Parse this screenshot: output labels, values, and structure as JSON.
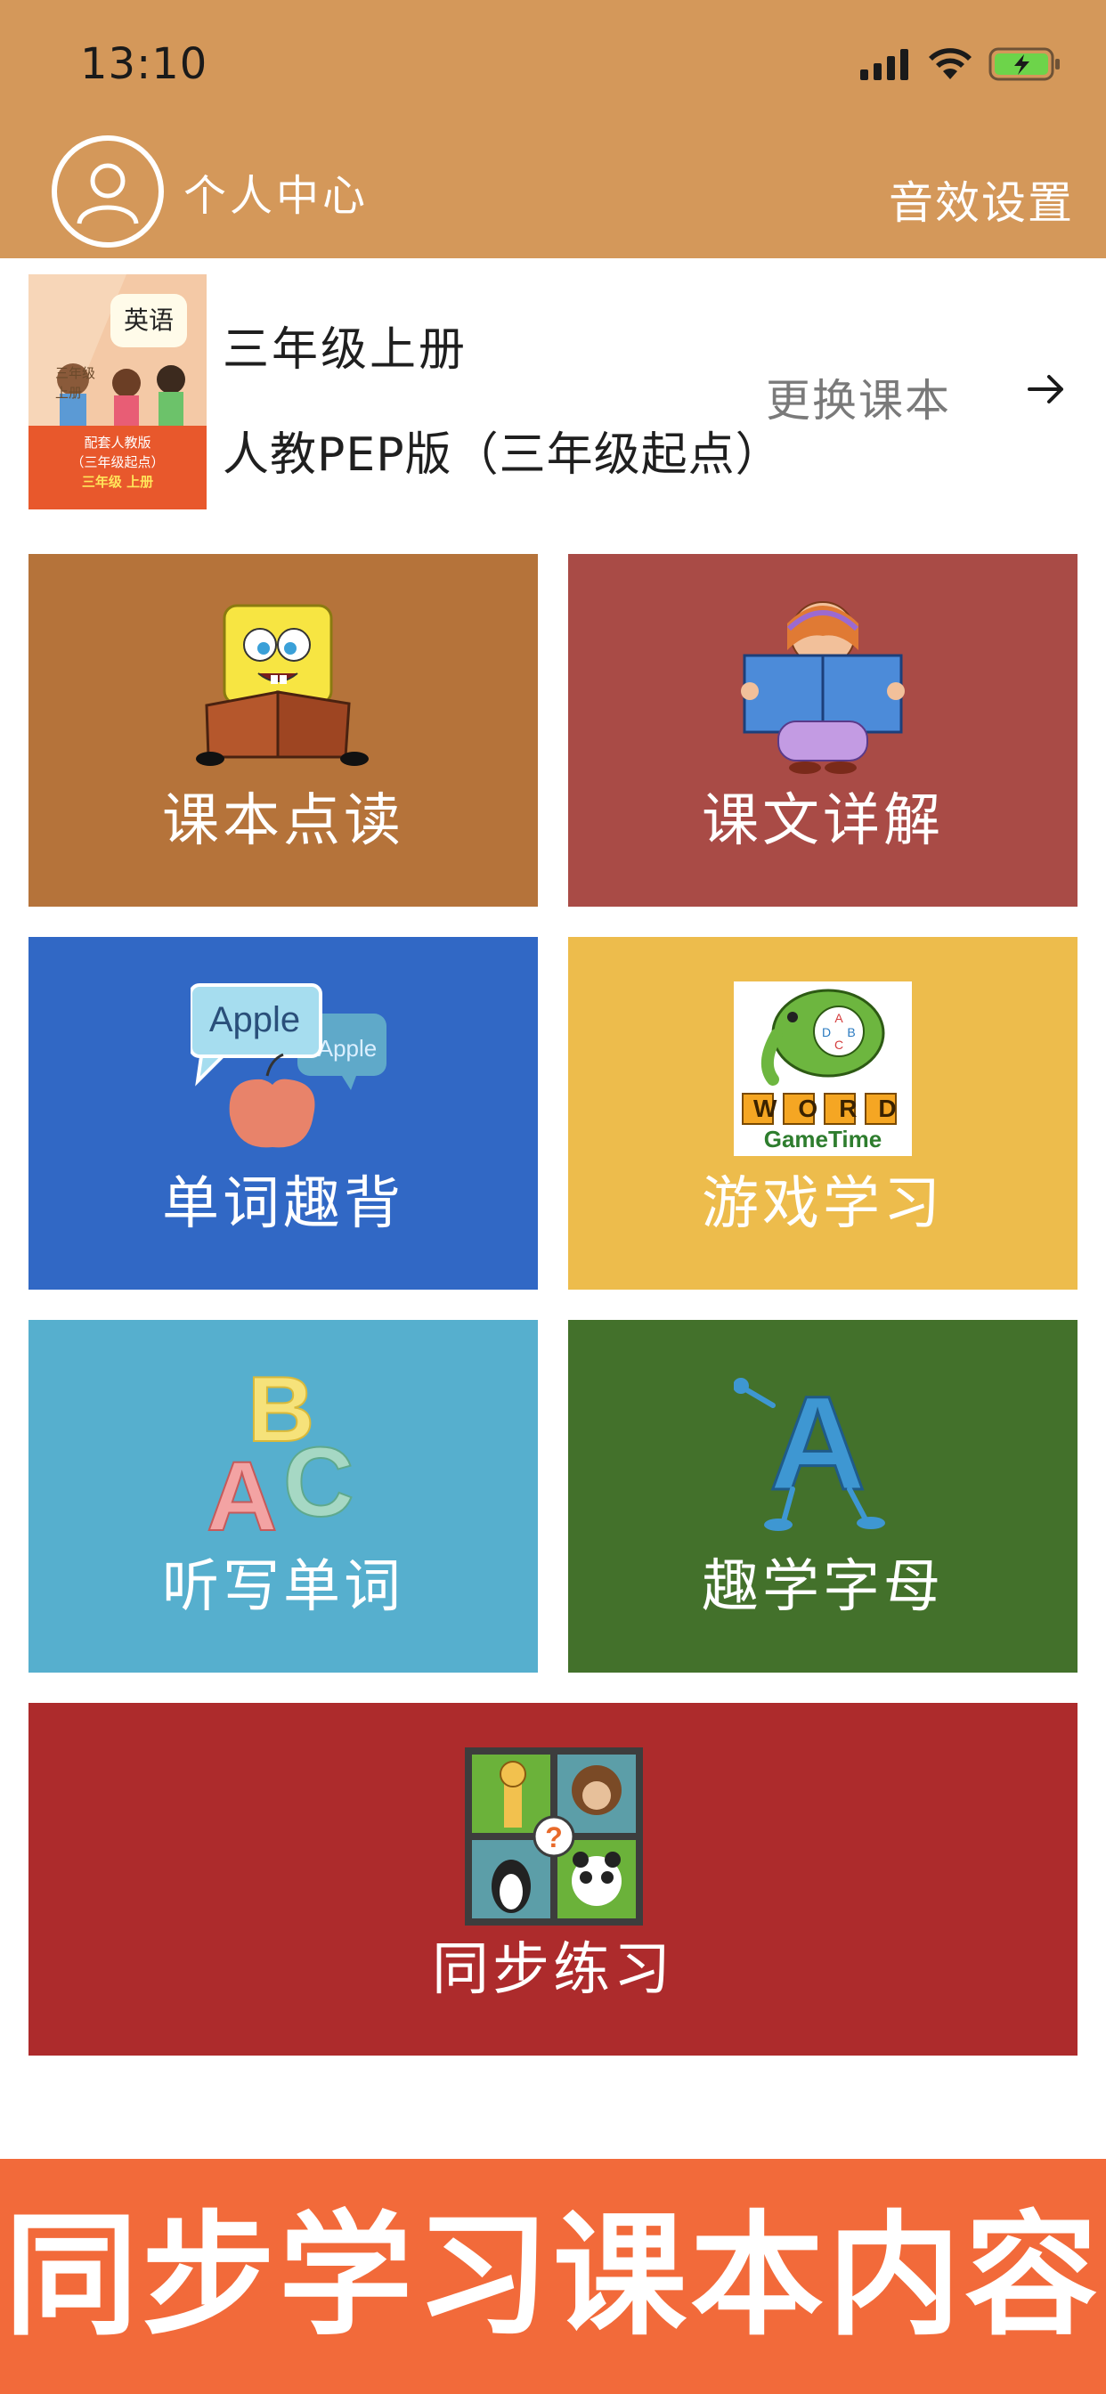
{
  "status_bar": {
    "time": "13:10"
  },
  "header": {
    "profile_label": "个人中心",
    "settings_label": "音效设置"
  },
  "book": {
    "grade": "三年级上册",
    "edition": "人教PEP版（三年级起点）",
    "change_label": "更换课本",
    "cover": {
      "title": "英语",
      "sub_line1": "三年级",
      "sub_line2": "上册",
      "band_line1": "配套人教版",
      "band_line2": "（三年级起点）",
      "band_line3": "三年级  上册"
    }
  },
  "tiles": [
    {
      "label": "课本点读",
      "color": "#B5733A"
    },
    {
      "label": "课文详解",
      "color": "#A94B46"
    },
    {
      "label": "单词趣背",
      "color": "#3168C5",
      "illus_text1": "Apple",
      "illus_text2": "Apple"
    },
    {
      "label": "游戏学习",
      "color": "#EDBC4C",
      "illus_word": "WORD",
      "illus_game": "GameTime"
    },
    {
      "label": "听写单词",
      "color": "#56AFCE",
      "illus_a": "A",
      "illus_b": "B",
      "illus_c": "C"
    },
    {
      "label": "趣学字母",
      "color": "#43712B",
      "illus_a": "A"
    },
    {
      "label": "同步练习",
      "color": "#AD2B2C"
    }
  ],
  "banner": {
    "text": "同步学习课本内容",
    "color": "#F26A3A"
  }
}
